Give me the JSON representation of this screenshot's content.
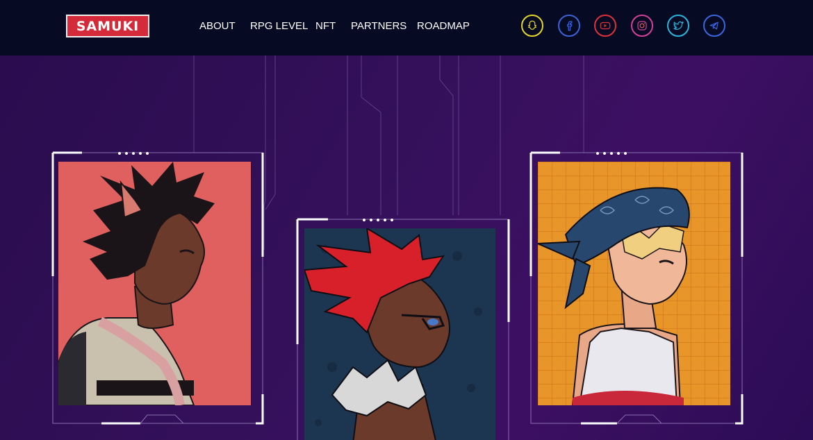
{
  "brand": {
    "logo_text": "SAMUKI",
    "logo_color": "#d42a3a"
  },
  "nav": {
    "items": [
      {
        "label": "ABOUT"
      },
      {
        "label": "RPG LEVEL"
      },
      {
        "label": "NFT"
      },
      {
        "label": "PARTNERS"
      },
      {
        "label": "ROADMAP"
      }
    ]
  },
  "social": [
    {
      "icon": "snapchat-icon",
      "color": "#e6d82a"
    },
    {
      "icon": "facebook-icon",
      "color": "#3a64d8"
    },
    {
      "icon": "youtube-icon",
      "color": "#e0323c"
    },
    {
      "icon": "instagram-icon",
      "color": "#d4409a"
    },
    {
      "icon": "twitter-icon",
      "color": "#2ab6e0"
    },
    {
      "icon": "telegram-icon",
      "color": "#3a68e0"
    }
  ],
  "cards": [
    {
      "name": "character-card-1",
      "background": "#e06060",
      "hair": "#1a1418"
    },
    {
      "name": "character-card-2",
      "background": "#1c3550",
      "hair": "#d8202a"
    },
    {
      "name": "character-card-3",
      "background": "#e8962a",
      "hair": "#f0d080"
    }
  ],
  "colors": {
    "header_bg": "#060a22",
    "page_bg": "#2f0e58"
  }
}
